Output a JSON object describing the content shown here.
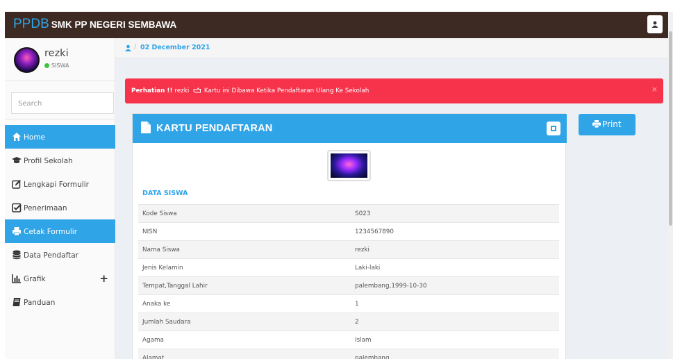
{
  "header": {
    "brand_main": "PPDB",
    "brand_sub": "SMK PP NEGERI SEMBAWA"
  },
  "user": {
    "name": "rezki",
    "role": "SISWA"
  },
  "search": {
    "placeholder": "Search"
  },
  "sidebar": {
    "items": [
      {
        "label": "Home",
        "icon": "home-icon"
      },
      {
        "label": "Profil Sekolah",
        "icon": "graduation-cap-icon"
      },
      {
        "label": "Lengkapi Formulir",
        "icon": "edit-icon"
      },
      {
        "label": "Penerimaan",
        "icon": "check-square-icon"
      },
      {
        "label": "Cetak Formulir",
        "icon": "print-icon"
      },
      {
        "label": "Data Pendaftar",
        "icon": "database-icon"
      },
      {
        "label": "Grafik",
        "icon": "bar-chart-icon",
        "expand": "+"
      },
      {
        "label": "Panduan",
        "icon": "book-icon"
      }
    ]
  },
  "breadcrumb": {
    "date": "02 December 2021"
  },
  "alert": {
    "strong": "Perhatian !!",
    "user": "rezki",
    "message": "Kartu ini Dibawa Ketika Pendaftaran Ulang Ke Sekolah",
    "close": "×"
  },
  "card": {
    "title": "KARTU PENDAFTARAN",
    "section": "DATA SISWA"
  },
  "print": {
    "label": "Print"
  },
  "student": {
    "rows": [
      {
        "k": "Kode Siswa",
        "v": "S023"
      },
      {
        "k": "NISN",
        "v": "1234567890"
      },
      {
        "k": "Nama Siswa",
        "v": "rezki"
      },
      {
        "k": "Jenis Kelamin",
        "v": "Laki-laki"
      },
      {
        "k": "Tempat,Tanggal Lahir",
        "v": "palembang,1999-10-30"
      },
      {
        "k": "Anaka ke",
        "v": "1"
      },
      {
        "k": "Jumlah Saudara",
        "v": "2"
      },
      {
        "k": "Agama",
        "v": "Islam"
      },
      {
        "k": "Alamat",
        "v": "palembang"
      }
    ]
  },
  "colors": {
    "accent": "#2fa4e7",
    "topbar": "#3d2a23",
    "alert": "#f7334b",
    "status": "#3dc43d"
  }
}
